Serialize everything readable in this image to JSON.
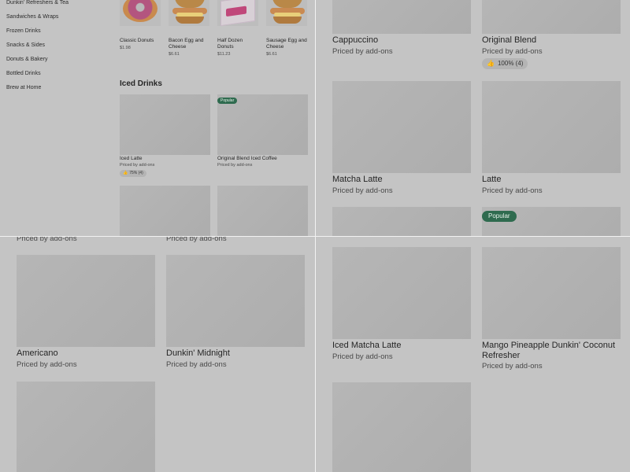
{
  "sidebar": {
    "items": [
      {
        "label": "Dunkin' Refreshers & Tea"
      },
      {
        "label": "Sandwiches & Wraps"
      },
      {
        "label": "Frozen Drinks"
      },
      {
        "label": "Snacks & Sides"
      },
      {
        "label": "Donuts & Bakery"
      },
      {
        "label": "Bottled Drinks"
      },
      {
        "label": "Brew at Home"
      }
    ]
  },
  "top_row": [
    {
      "name": "Classic Donuts",
      "price": "$1.98",
      "image": "donut"
    },
    {
      "name": "Bacon Egg and Cheese",
      "price": "$6.61",
      "image": "sandwich"
    },
    {
      "name": "Half Dozen Donuts",
      "price": "$11.23",
      "image": "donut-box"
    },
    {
      "name": "Sausage Egg and Cheese",
      "price": "$6.61",
      "image": "sandwich"
    }
  ],
  "section": {
    "title": "Iced Drinks"
  },
  "iced_drinks": [
    {
      "name": "Iced Latte",
      "price": "Priced by add-ons",
      "rating": "75% (4)",
      "rating_icon": "thumbs-up-icon"
    },
    {
      "name": "Original Blend Iced Coffee",
      "price": "Priced by add-ons",
      "badge": "Popular"
    }
  ],
  "hot_drinks": [
    {
      "name": "Cappuccino",
      "price": "Priced by add-ons"
    },
    {
      "name": "Original Blend",
      "price": "Priced by add-ons",
      "rating": "100% (4)",
      "rating_icon": "thumbs-up-icon"
    },
    {
      "name": "Matcha Latte",
      "price": "Priced by add-ons"
    },
    {
      "name": "Latte",
      "price": "Priced by add-ons",
      "next_badge": "Popular"
    }
  ],
  "q3": {
    "partial_prices": [
      "Priced by add-ons",
      "Priced by add-ons"
    ],
    "items": [
      {
        "name": "Americano",
        "price": "Priced by add-ons"
      },
      {
        "name": "Dunkin' Midnight",
        "price": "Priced by add-ons"
      }
    ]
  },
  "q4": {
    "items": [
      {
        "name": "Iced Matcha Latte",
        "price": "Priced by add-ons"
      },
      {
        "name": "Mango Pineapple Dunkin' Coconut Refresher",
        "price": "Priced by add-ons"
      }
    ]
  },
  "colors": {
    "badge_green": "#2f6b4f",
    "overlay_gray": "#c4c4c4",
    "divider": "#f2f2f2"
  }
}
